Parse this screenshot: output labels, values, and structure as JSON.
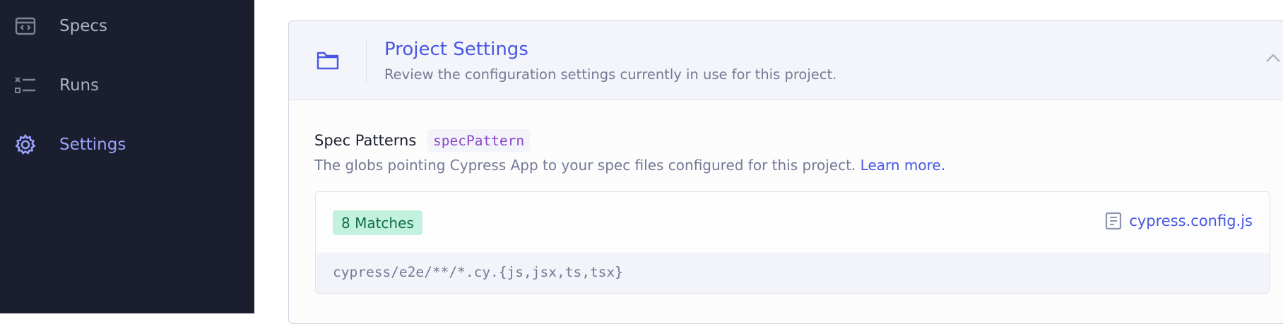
{
  "sidebar": {
    "items": [
      {
        "label": "Specs",
        "icon": "code-browser-icon",
        "active": false
      },
      {
        "label": "Runs",
        "icon": "runs-list-icon",
        "active": false
      },
      {
        "label": "Settings",
        "icon": "gear-icon",
        "active": true
      }
    ]
  },
  "project_settings": {
    "title": "Project Settings",
    "subtitle": "Review the configuration settings currently in use for this project.",
    "icon": "folder-icon",
    "collapse_icon": "chevron-up-icon"
  },
  "spec_patterns": {
    "title": "Spec Patterns",
    "code_label": "specPattern",
    "description": "The globs pointing Cypress App to your spec files configured for this project.",
    "learn_more": "Learn more.",
    "matches_badge": "8 Matches",
    "config_file": "cypress.config.js",
    "pattern": "cypress/e2e/**/*.cy.{js,jsx,ts,tsx}"
  },
  "colors": {
    "sidebar_bg": "#1b1e2e",
    "accent": "#4956e3",
    "active_nav": "#9aa2fc",
    "badge_bg": "#c2f1de",
    "badge_text": "#0f6e4a",
    "code_purple": "#8b46c9"
  }
}
